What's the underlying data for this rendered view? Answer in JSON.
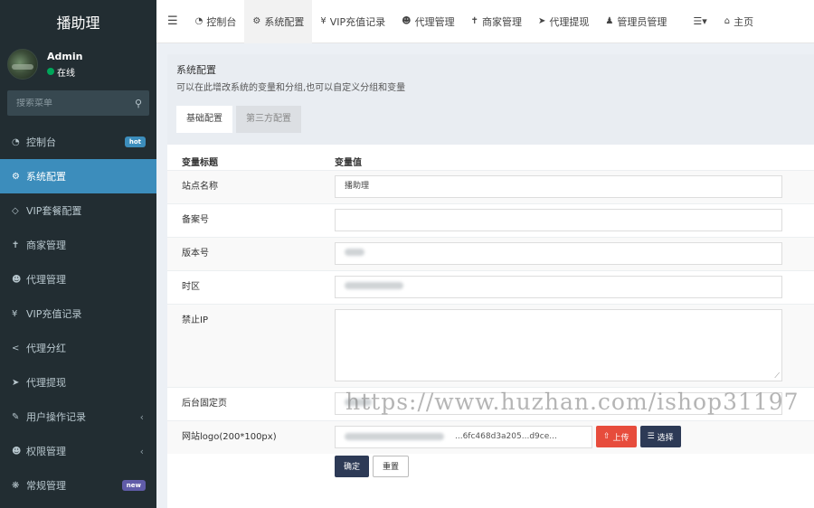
{
  "brand": {
    "title": "播助理"
  },
  "user": {
    "name": "Admin",
    "status": "在线"
  },
  "search": {
    "placeholder": "搜索菜单"
  },
  "sidebar": {
    "items": [
      {
        "label": "控制台",
        "icon": "dashboard-icon",
        "badge": "hot"
      },
      {
        "label": "系统配置",
        "icon": "gear-icon",
        "active": true
      },
      {
        "label": "VIP套餐配置",
        "icon": "diamond-icon"
      },
      {
        "label": "商家管理",
        "icon": "shirt-icon"
      },
      {
        "label": "代理管理",
        "icon": "users-icon"
      },
      {
        "label": "VIP充值记录",
        "icon": "yen-icon"
      },
      {
        "label": "代理分红",
        "icon": "share-icon"
      },
      {
        "label": "代理提现",
        "icon": "arrow-circle-icon"
      },
      {
        "label": "用户操作记录",
        "icon": "log-icon",
        "expandable": true
      },
      {
        "label": "权限管理",
        "icon": "group-icon",
        "expandable": true
      },
      {
        "label": "常规管理",
        "icon": "cogs-icon",
        "badge": "new"
      }
    ]
  },
  "topnav": {
    "items": [
      {
        "label": "控制台",
        "icon": "dashboard-icon"
      },
      {
        "label": "系统配置",
        "icon": "gear-icon",
        "active": true
      },
      {
        "label": "VIP充值记录",
        "icon": "yen-icon"
      },
      {
        "label": "代理管理",
        "icon": "users-icon"
      },
      {
        "label": "商家管理",
        "icon": "shirt-icon"
      },
      {
        "label": "代理提现",
        "icon": "arrow-circle-icon"
      },
      {
        "label": "管理员管理",
        "icon": "user-icon"
      }
    ],
    "home": "主页"
  },
  "panel": {
    "title": "系统配置",
    "description": "可以在此增改系统的变量和分组,也可以自定义分组和变量",
    "tabs": [
      "基础配置",
      "第三方配置"
    ]
  },
  "table": {
    "headers": [
      "变量标题",
      "变量值"
    ],
    "rows": [
      {
        "label": "站点名称",
        "value": "播助理"
      },
      {
        "label": "备案号",
        "value": ""
      },
      {
        "label": "版本号",
        "value": ""
      },
      {
        "label": "时区",
        "value": ""
      },
      {
        "label": "禁止IP",
        "value": ""
      },
      {
        "label": "后台固定页",
        "value": ""
      },
      {
        "label": "网站logo(200*100px)",
        "value": "...6fc468d3a205...d9ce..."
      }
    ]
  },
  "buttons": {
    "upload": "上传",
    "choose": "选择",
    "ok": "确定",
    "reset": "重置"
  },
  "watermark": "https://www.huzhan.com/ishop31197",
  "colors": {
    "sidebar_bg": "#222d32",
    "active": "#3c8dbc",
    "upload": "#e74c3c",
    "primary": "#2d3a56"
  }
}
